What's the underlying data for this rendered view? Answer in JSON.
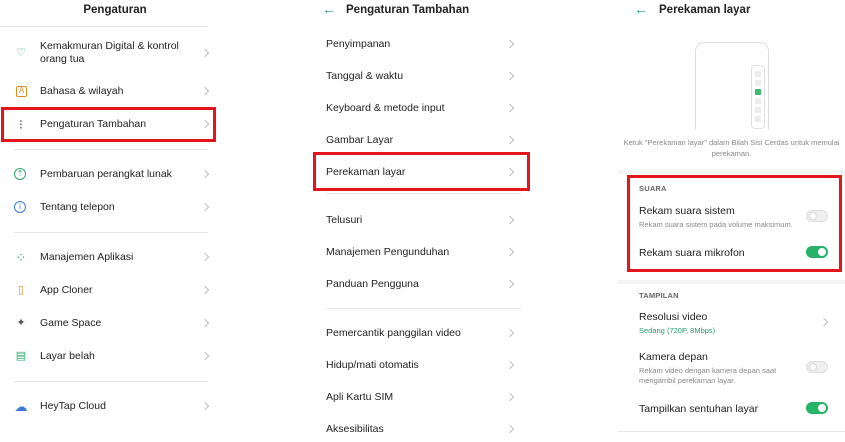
{
  "colors": {
    "accent": "#21a06a",
    "highlight": "#e3141b",
    "toggle_on": "#24b367"
  },
  "panel1": {
    "title": "Pengaturan",
    "items": [
      {
        "icon": "heart-child-icon",
        "glyph": "♡",
        "label": "Kemakmuran Digital & kontrol orang tua"
      },
      {
        "icon": "language-icon",
        "glyph": "A",
        "label": "Bahasa & wilayah"
      },
      {
        "icon": "more-settings-icon",
        "glyph": "⁝",
        "label": "Pengaturan Tambahan"
      },
      {
        "icon": "update-icon",
        "glyph": "⇡",
        "label": "Pembaruan perangkat lunak"
      },
      {
        "icon": "info-icon",
        "glyph": "i",
        "label": "Tentang telepon"
      },
      {
        "icon": "apps-icon",
        "glyph": "⁘",
        "label": "Manajemen Aplikasi"
      },
      {
        "icon": "app-cloner-icon",
        "glyph": "▯",
        "label": "App Cloner"
      },
      {
        "icon": "game-space-icon",
        "glyph": "✦",
        "label": "Game Space"
      },
      {
        "icon": "split-screen-icon",
        "glyph": "▤",
        "label": "Layar belah"
      },
      {
        "icon": "cloud-icon",
        "glyph": "☁",
        "label": "HeyTap Cloud"
      }
    ]
  },
  "panel2": {
    "back": "←",
    "title": "Pengaturan Tambahan",
    "items": [
      "Penyimpanan",
      "Tanggal & waktu",
      "Keyboard & metode input",
      "Gambar Layar",
      "Perekaman layar",
      "Telusuri",
      "Manajemen Pengunduhan",
      "Panduan Pengguna",
      "Pemercantik panggilan video",
      "Hidup/mati otomatis",
      "Apli Kartu SIM",
      "Aksesibilitas"
    ]
  },
  "panel3": {
    "back": "←",
    "title": "Perekaman layar",
    "hint": "Ketuk \"Perekaman layar\" dalam Bilah Sisi Cerdas untuk memulai perekaman.",
    "section_sound": "SUARA",
    "system_audio": {
      "title": "Rekam suara sistem",
      "subtitle": "Rekam suara sistem pada volume maksimum.",
      "on": false
    },
    "mic_audio": {
      "title": "Rekam suara mikrofon",
      "on": true
    },
    "section_display": "TAMPILAN",
    "resolution": {
      "title": "Resolusi video",
      "value": "Sedang (720P, 8Mbps)"
    },
    "front_camera": {
      "title": "Kamera depan",
      "subtitle": "Rekam video dengan kamera depan saat mengambil perekaman layar.",
      "on": false
    },
    "show_touches": {
      "title": "Tampilkan sentuhan layar",
      "on": true
    }
  }
}
